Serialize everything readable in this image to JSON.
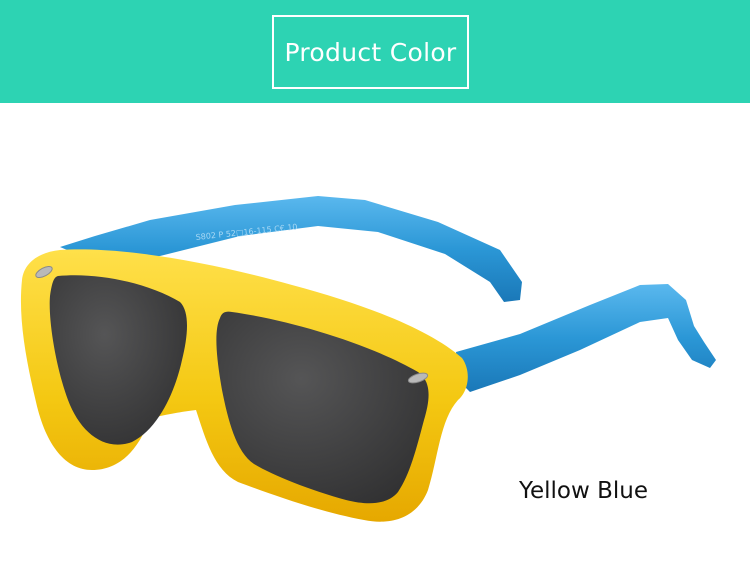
{
  "banner": {
    "title": "Product Color",
    "background_color": "#2dd3b3"
  },
  "product": {
    "color_label": "Yellow Blue",
    "temple_imprint": "S802 P 52□16-115 C€ 10",
    "frame_color": "#f4c812",
    "temple_color": "#2b97d6",
    "lens_color": "#3e3e3f"
  }
}
